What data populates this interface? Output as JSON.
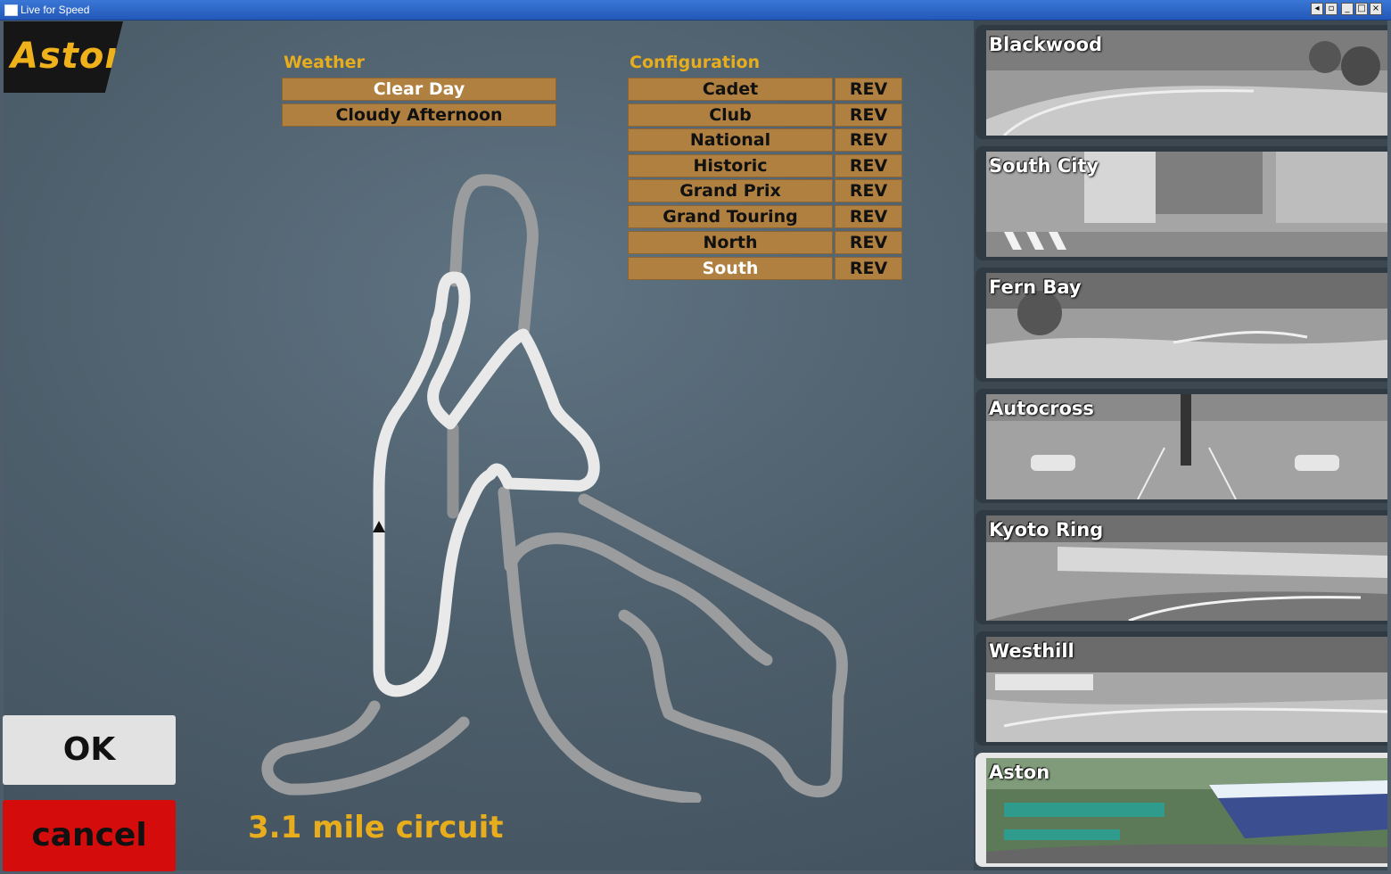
{
  "window": {
    "title": "Live for Speed"
  },
  "selected_track": "Aston",
  "weather": {
    "label": "Weather",
    "options": [
      "Clear Day",
      "Cloudy Afternoon"
    ],
    "selected": "Clear Day"
  },
  "configuration": {
    "label": "Configuration",
    "options": [
      "Cadet",
      "Club",
      "National",
      "Historic",
      "Grand Prix",
      "Grand Touring",
      "North",
      "South"
    ],
    "reverse_label": "REV",
    "selected": "South"
  },
  "buttons": {
    "ok": "OK",
    "cancel": "cancel"
  },
  "circuit_length": "3.1 mile circuit",
  "tracks": [
    "Blackwood",
    "South City",
    "Fern Bay",
    "Autocross",
    "Kyoto Ring",
    "Westhill",
    "Aston"
  ],
  "colors": {
    "accent": "#e7ad1c",
    "option_bg": "#b08040",
    "cancel": "#d40c0c"
  }
}
